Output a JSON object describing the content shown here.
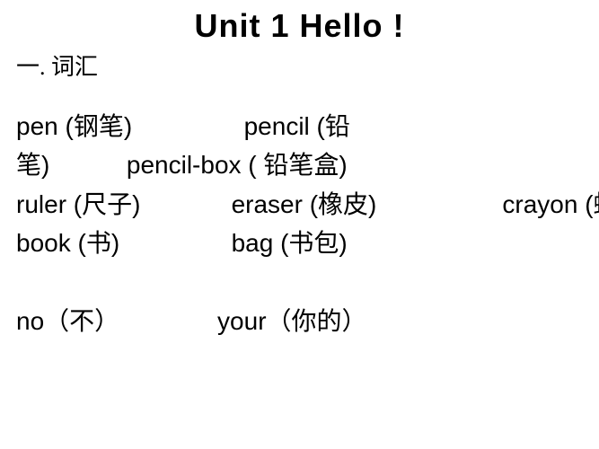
{
  "title": "Unit 1      Hello !",
  "section_header": "一. 词汇",
  "lines": {
    "l1": "pen (钢笔)                pencil (铅",
    "l2": "笔)           pencil-box ( 铅笔盒)",
    "l3": "ruler (尺子)             eraser (橡皮)                  crayon (蜡笔)",
    "l4": "book (书)                bag (书包)",
    "l5": "no（不）              your（你的）"
  }
}
